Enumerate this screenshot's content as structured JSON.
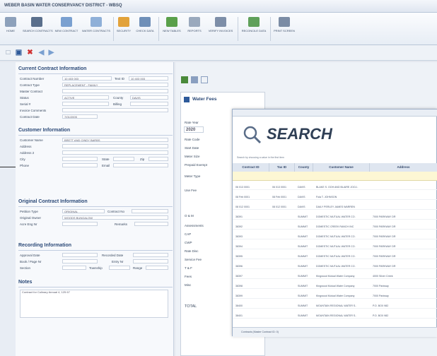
{
  "window": {
    "title": "WEBER BASIN WATER CONSERVANCY DISTRICT - WBSQ"
  },
  "ribbon": [
    {
      "label": "HOME",
      "icon": "home-icon",
      "color": "#8da1bb"
    },
    {
      "label": "SEARCH CONTRACTS",
      "icon": "binoculars-icon",
      "color": "#5a6f8c"
    },
    {
      "label": "NEW CONTRACT",
      "icon": "new-document-icon",
      "color": "#7aa0d0"
    },
    {
      "label": "WATER CONTRACTS",
      "icon": "water-contracts-icon",
      "color": "#8fb0d8"
    },
    {
      "label": "SECURITY",
      "icon": "lock-icon",
      "color": "#e2a23a"
    },
    {
      "label": "CHECK DATA",
      "icon": "check-data-icon",
      "color": "#6f8fb8"
    },
    {
      "label": "NEW TABLES",
      "icon": "table-icon",
      "color": "#5aa04a"
    },
    {
      "label": "REPORTS",
      "icon": "reports-icon",
      "color": "#9aa9bd"
    },
    {
      "label": "VERIFY INVOICES",
      "icon": "invoice-icon",
      "color": "#7d8ea8"
    },
    {
      "label": "RECONCILE DATA",
      "icon": "reconcile-icon",
      "color": "#5fa05a"
    },
    {
      "label": "PRINT SCREEN",
      "icon": "printer-icon",
      "color": "#7b8ca5"
    }
  ],
  "quickbar": [
    {
      "icon": "new-icon",
      "glyph": "□",
      "color": "#7e8fa8"
    },
    {
      "icon": "save-icon",
      "glyph": "▣",
      "color": "#2e5a9a"
    },
    {
      "icon": "delete-icon",
      "glyph": "✖",
      "color": "#d03030"
    },
    {
      "icon": "back-icon",
      "glyph": "◀",
      "color": "#7aa0d0"
    },
    {
      "icon": "forward-icon",
      "glyph": "▶",
      "color": "#7aa0d0"
    }
  ],
  "current": {
    "header": "Current Contract Information",
    "contract_number_label": "Contract Number",
    "contract_number": "10 403 003",
    "text_id_label": "Text ID",
    "text_id": "10 403 003",
    "contract_type_label": "Contract Type",
    "contract_type": "REPLACEMENT - FAMILY",
    "master_contract_label": "Master Contract",
    "master_contract": "",
    "status_label": "Status",
    "status": "ACTIVE",
    "county_label": "County",
    "county": "DAVIS",
    "serial_label": "Serial #",
    "billing_label": "Billing",
    "billing": "",
    "invoice_comments_label": "Invoice Comments",
    "invoice_comments": "",
    "contract_date_label": "Contract Date",
    "contract_date": "7/01/2005"
  },
  "customer": {
    "header": "Customer Information",
    "name_label": "Customer Name",
    "name": "BRETT AND CINDY BARBS",
    "address_label": "Address",
    "address": "",
    "address2_label": "Address 2",
    "address2": "",
    "city_label": "City",
    "city": "",
    "state_label": "State",
    "state": "",
    "zip_label": "Zip",
    "zip": "",
    "phone_label": "Phone",
    "phone": "",
    "email_label": "Email",
    "email": ""
  },
  "original": {
    "header": "Original Contract Information",
    "petition_label": "Petition Type",
    "petition": "ORIGINAL",
    "contract_no_label": "Contract No",
    "contract_no": "",
    "owner_label": "Original Owner",
    "owner": "WOODS BUNGALOW",
    "acre_label": "Acre Eng Nr",
    "acre": "",
    "remarks_label": "Remarks",
    "remarks": ""
  },
  "recording": {
    "header": "Recording Information",
    "approval_label": "Approval Date",
    "approval": "",
    "recorded_label": "Recorded Date",
    "recorded": "",
    "book_label": "Book / Page Nr",
    "book": "",
    "entry_label": "Entry Nr",
    "entry": "",
    "section_label": "Section",
    "section": "",
    "township_label": "Township",
    "township": "",
    "range_label": "Range",
    "range": ""
  },
  "notes": {
    "header": "Notes",
    "text": "Contract for Culinary Annual 4, 125 67"
  },
  "water_fees": {
    "title": "Water Fees",
    "year_label": "Rate Year",
    "year": "2020",
    "labels": [
      "Rate Code",
      "Start Date",
      "Meter Size",
      "Prepaid Exempt",
      "Meter Type",
      "Use Fee",
      "O & M",
      "Assessments",
      "CAP",
      "CWP",
      "Rate Disc",
      "Service Fee",
      "T & F",
      "Fees",
      "Misc",
      "TOTAL"
    ]
  },
  "search": {
    "title": "SEARCH",
    "hint": "Search by choosing a value in the first item",
    "columns": [
      "Contract ID",
      "Tax ID",
      "County",
      "Customer Name",
      "Address"
    ],
    "rows": [
      [
        "06 013 0001",
        "06 013 0001",
        "DAVIS",
        "BLAKE S. OOH AND BLAIRE JOOJ..",
        ""
      ],
      [
        "08 Feb 0001",
        "08 Feb 0001",
        "DAVIS",
        "Fola T. JOHNSON",
        ""
      ],
      [
        "08 012 0001",
        "08 012 0001",
        "DAVIS",
        "DAILY PERLEY JAMES WARREN",
        ""
      ],
      [
        "38391",
        "",
        "SUMMIT",
        "DOMESTIC MUTUAL WATER CO.",
        "7000 PARKWAY DR"
      ],
      [
        "38392",
        "",
        "SUMMIT",
        "DOMESTIC CREEK RANCH INC",
        "7000 PARKWAY DR"
      ],
      [
        "38393",
        "",
        "SUMMIT",
        "DOMESTIC MUTUAL WATER CO.",
        "7000 PARKWAY DR"
      ],
      [
        "38394",
        "",
        "SUMMIT",
        "DOMESTIC MUTUAL WATER CO.",
        "7000 PARKWAY DR"
      ],
      [
        "38395",
        "",
        "SUMMIT",
        "DOMESTIC MUTUAL WATER CO.",
        "7000 PARKWAY DR"
      ],
      [
        "38396",
        "",
        "SUMMIT",
        "DOMESTIC MUTUAL WATER CO.",
        "7000 PARKWAY DR"
      ],
      [
        "38397",
        "",
        "SUMMIT",
        "Kingwood Mutual Water Company",
        "4000 Silver Creek"
      ],
      [
        "38398",
        "",
        "SUMMIT",
        "Kingwood Mutual Water Company",
        "7000 Parkway"
      ],
      [
        "38399",
        "",
        "SUMMIT",
        "Kingwood Mutual Water Company",
        "7000 Parkway"
      ],
      [
        "38400",
        "",
        "SUMMIT",
        "MOUNTAIN REGIONAL WATER S..",
        "P.O. BOX 982"
      ],
      [
        "38401",
        "",
        "SUMMIT",
        "MOUNTAIN REGIONAL WATER S..",
        "P.O. BOX 982"
      ]
    ],
    "footer": "Contracts (Master Contract ID: 0)"
  }
}
